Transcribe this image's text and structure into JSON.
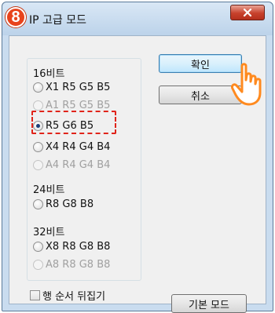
{
  "window": {
    "title": "IP 고급 모드",
    "step_number": "8"
  },
  "groups": [
    {
      "label": "16비트",
      "options": [
        {
          "label": "X1 R5 G5 B5",
          "checked": false,
          "enabled": true
        },
        {
          "label": "A1 R5 G5 B5",
          "checked": false,
          "enabled": false
        },
        {
          "label": "R5 G6 B5",
          "checked": true,
          "enabled": true
        },
        {
          "label": "X4 R4 G4 B4",
          "checked": false,
          "enabled": true
        },
        {
          "label": "A4 R4 G4 B4",
          "checked": false,
          "enabled": false
        }
      ]
    },
    {
      "label": "24비트",
      "options": [
        {
          "label": "R8 G8 B8",
          "checked": false,
          "enabled": true
        }
      ]
    },
    {
      "label": "32비트",
      "options": [
        {
          "label": "X8 R8 G8 B8",
          "checked": false,
          "enabled": true
        },
        {
          "label": "A8 R8 G8 B8",
          "checked": false,
          "enabled": false
        }
      ]
    }
  ],
  "buttons": {
    "ok_label": "확인",
    "cancel_label": "취소",
    "default_mode_label": "기본 모드"
  },
  "options": {
    "reverse_row_order_label": "행 순서 뒤집기",
    "reverse_row_order_checked": false
  },
  "colors": {
    "step_badge": "#e8431c",
    "highlight_dashed": "#e0241a",
    "close_button": "#c7412c"
  },
  "icons": {
    "close": "close-icon",
    "pointer": "hand-pointer-icon"
  }
}
